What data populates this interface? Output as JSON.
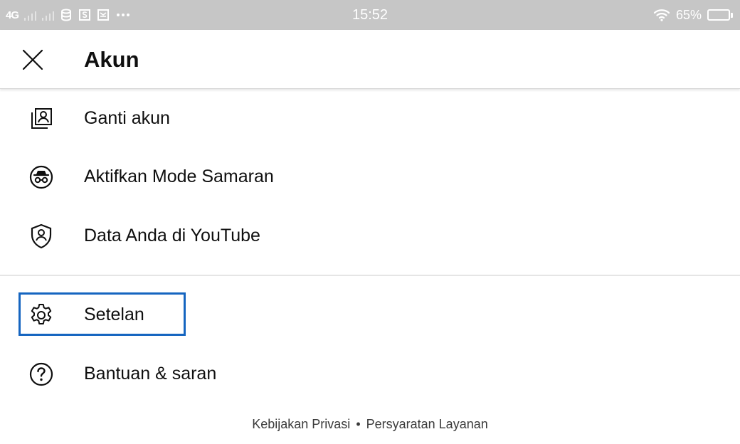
{
  "status_bar": {
    "network": "4G",
    "time": "15:52",
    "battery_percent": "65%",
    "battery_level": 0.65,
    "icons": [
      "signal-bars-icon",
      "database-icon",
      "s-app-icon",
      "mail-icon",
      "more-dots-icon",
      "wifi-icon",
      "battery-icon"
    ]
  },
  "header": {
    "title": "Akun",
    "close_icon": "close-icon"
  },
  "menu": {
    "items": [
      {
        "label": "Ganti akun",
        "icon": "switch-account-icon"
      },
      {
        "label": "Aktifkan Mode Samaran",
        "icon": "incognito-icon"
      },
      {
        "label": "Data Anda di YouTube",
        "icon": "shield-user-icon"
      },
      {
        "label": "Setelan",
        "icon": "gear-icon"
      },
      {
        "label": "Bantuan & saran",
        "icon": "help-icon"
      }
    ]
  },
  "footer": {
    "privacy_label": "Kebijakan Privasi",
    "separator": "•",
    "terms_label": "Persyaratan Layanan"
  },
  "colors": {
    "status_bar_bg": "#c6c6c6",
    "text_primary": "#0f0f0f",
    "highlight_border": "#1565c0"
  }
}
